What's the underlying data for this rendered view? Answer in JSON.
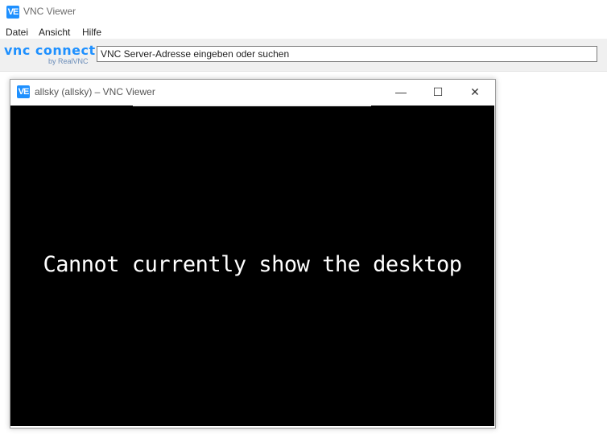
{
  "app": {
    "title": "VNC Viewer",
    "logo_icon": "vnc-viewer-logo"
  },
  "menu": {
    "items": [
      "Datei",
      "Ansicht",
      "Hilfe"
    ]
  },
  "toolbar": {
    "brand_main": "vnc connect",
    "brand_sub": "by RealVNC",
    "address_value": "VNC Server-Adresse eingeben oder suchen"
  },
  "child_window": {
    "title": "allsky (allsky) – VNC Viewer",
    "buttons": {
      "minimize": "—",
      "maximize": "☐",
      "close": "✕"
    },
    "message": "Cannot currently show the desktop"
  },
  "colors": {
    "brand": "#1e90ff",
    "desktop_bg": "#000000",
    "toolbar_bg": "#f0f0f0"
  }
}
